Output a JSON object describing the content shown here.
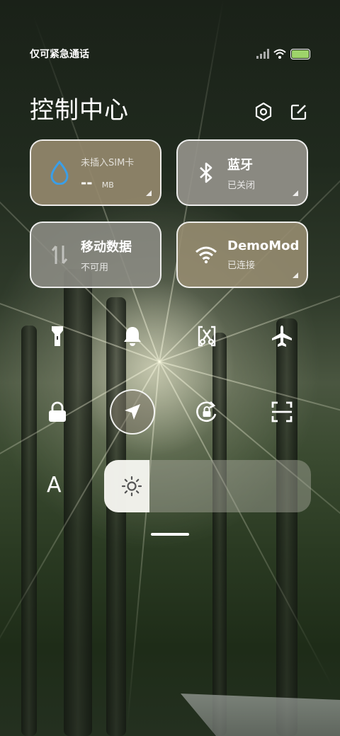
{
  "status_bar": {
    "carrier_text": "仅可紧急通话",
    "icons": [
      "signal-icon",
      "wifi-icon",
      "battery-icon"
    ],
    "battery_color": "#9ed36a"
  },
  "header": {
    "title": "控制中心",
    "settings_icon": "settings-icon",
    "edit_icon": "edit-icon"
  },
  "tiles": {
    "data_usage": {
      "main": "未插入SIM卡",
      "value": "--",
      "unit": "MB",
      "icon": "water-drop-icon",
      "accent": "#3a9ee8"
    },
    "bluetooth": {
      "main": "蓝牙",
      "sub": "已关闭",
      "icon": "bluetooth-icon"
    },
    "mobile_data": {
      "main": "移动数据",
      "sub": "不可用",
      "icon": "data-arrows-icon"
    },
    "wifi": {
      "main": "DemoMod",
      "sub": "已连接",
      "icon": "wifi-icon"
    }
  },
  "quick_buttons": [
    {
      "name": "flashlight",
      "icon": "flashlight-icon"
    },
    {
      "name": "ring",
      "icon": "bell-icon"
    },
    {
      "name": "screenshot",
      "icon": "scissors-icon"
    },
    {
      "name": "airplane",
      "icon": "airplane-icon"
    },
    {
      "name": "lock",
      "icon": "lock-icon"
    },
    {
      "name": "location",
      "icon": "navigation-arrow-icon",
      "active": true
    },
    {
      "name": "rotation",
      "icon": "rotation-lock-icon"
    },
    {
      "name": "scanner",
      "icon": "scan-icon"
    }
  ],
  "brightness": {
    "label_icon": "font-size-icon",
    "label_text": "A",
    "level": 0.22,
    "icon": "sun-icon"
  }
}
